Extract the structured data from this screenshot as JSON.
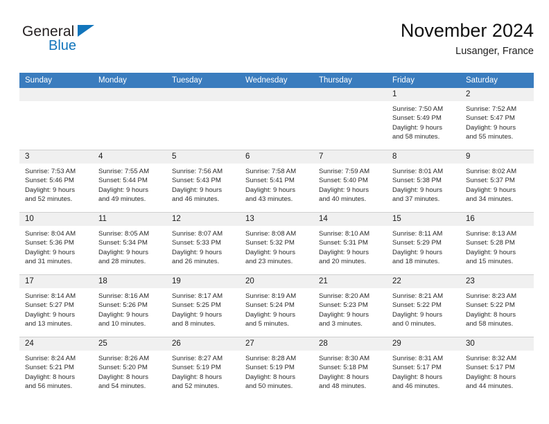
{
  "brand": {
    "name_part1": "General",
    "name_part2": "Blue",
    "triangle_color": "#1275bc",
    "text_color": "#231f20"
  },
  "header": {
    "title": "November 2024",
    "subtitle": "Lusanger, France"
  },
  "theme": {
    "header_blue": "#3a7cbe",
    "daynum_band": "#f0f0f0",
    "grid_line": "#cfcfcf",
    "page_background": "#ffffff"
  },
  "calendar": {
    "weekday_headers": [
      "Sunday",
      "Monday",
      "Tuesday",
      "Wednesday",
      "Thursday",
      "Friday",
      "Saturday"
    ],
    "labels": {
      "sunrise_prefix": "Sunrise:",
      "sunset_prefix": "Sunset:",
      "daylight_prefix": "Daylight:"
    },
    "weeks": [
      [
        {
          "day": "",
          "empty": true,
          "sunrise": "",
          "sunset": "",
          "daylight_line1": "",
          "daylight_line2": ""
        },
        {
          "day": "",
          "empty": true,
          "sunrise": "",
          "sunset": "",
          "daylight_line1": "",
          "daylight_line2": ""
        },
        {
          "day": "",
          "empty": true,
          "sunrise": "",
          "sunset": "",
          "daylight_line1": "",
          "daylight_line2": ""
        },
        {
          "day": "",
          "empty": true,
          "sunrise": "",
          "sunset": "",
          "daylight_line1": "",
          "daylight_line2": ""
        },
        {
          "day": "",
          "empty": true,
          "sunrise": "",
          "sunset": "",
          "daylight_line1": "",
          "daylight_line2": ""
        },
        {
          "day": "1",
          "empty": false,
          "sunrise": "Sunrise: 7:50 AM",
          "sunset": "Sunset: 5:49 PM",
          "daylight_line1": "Daylight: 9 hours",
          "daylight_line2": "and 58 minutes."
        },
        {
          "day": "2",
          "empty": false,
          "sunrise": "Sunrise: 7:52 AM",
          "sunset": "Sunset: 5:47 PM",
          "daylight_line1": "Daylight: 9 hours",
          "daylight_line2": "and 55 minutes."
        }
      ],
      [
        {
          "day": "3",
          "empty": false,
          "sunrise": "Sunrise: 7:53 AM",
          "sunset": "Sunset: 5:46 PM",
          "daylight_line1": "Daylight: 9 hours",
          "daylight_line2": "and 52 minutes."
        },
        {
          "day": "4",
          "empty": false,
          "sunrise": "Sunrise: 7:55 AM",
          "sunset": "Sunset: 5:44 PM",
          "daylight_line1": "Daylight: 9 hours",
          "daylight_line2": "and 49 minutes."
        },
        {
          "day": "5",
          "empty": false,
          "sunrise": "Sunrise: 7:56 AM",
          "sunset": "Sunset: 5:43 PM",
          "daylight_line1": "Daylight: 9 hours",
          "daylight_line2": "and 46 minutes."
        },
        {
          "day": "6",
          "empty": false,
          "sunrise": "Sunrise: 7:58 AM",
          "sunset": "Sunset: 5:41 PM",
          "daylight_line1": "Daylight: 9 hours",
          "daylight_line2": "and 43 minutes."
        },
        {
          "day": "7",
          "empty": false,
          "sunrise": "Sunrise: 7:59 AM",
          "sunset": "Sunset: 5:40 PM",
          "daylight_line1": "Daylight: 9 hours",
          "daylight_line2": "and 40 minutes."
        },
        {
          "day": "8",
          "empty": false,
          "sunrise": "Sunrise: 8:01 AM",
          "sunset": "Sunset: 5:38 PM",
          "daylight_line1": "Daylight: 9 hours",
          "daylight_line2": "and 37 minutes."
        },
        {
          "day": "9",
          "empty": false,
          "sunrise": "Sunrise: 8:02 AM",
          "sunset": "Sunset: 5:37 PM",
          "daylight_line1": "Daylight: 9 hours",
          "daylight_line2": "and 34 minutes."
        }
      ],
      [
        {
          "day": "10",
          "empty": false,
          "sunrise": "Sunrise: 8:04 AM",
          "sunset": "Sunset: 5:36 PM",
          "daylight_line1": "Daylight: 9 hours",
          "daylight_line2": "and 31 minutes."
        },
        {
          "day": "11",
          "empty": false,
          "sunrise": "Sunrise: 8:05 AM",
          "sunset": "Sunset: 5:34 PM",
          "daylight_line1": "Daylight: 9 hours",
          "daylight_line2": "and 28 minutes."
        },
        {
          "day": "12",
          "empty": false,
          "sunrise": "Sunrise: 8:07 AM",
          "sunset": "Sunset: 5:33 PM",
          "daylight_line1": "Daylight: 9 hours",
          "daylight_line2": "and 26 minutes."
        },
        {
          "day": "13",
          "empty": false,
          "sunrise": "Sunrise: 8:08 AM",
          "sunset": "Sunset: 5:32 PM",
          "daylight_line1": "Daylight: 9 hours",
          "daylight_line2": "and 23 minutes."
        },
        {
          "day": "14",
          "empty": false,
          "sunrise": "Sunrise: 8:10 AM",
          "sunset": "Sunset: 5:31 PM",
          "daylight_line1": "Daylight: 9 hours",
          "daylight_line2": "and 20 minutes."
        },
        {
          "day": "15",
          "empty": false,
          "sunrise": "Sunrise: 8:11 AM",
          "sunset": "Sunset: 5:29 PM",
          "daylight_line1": "Daylight: 9 hours",
          "daylight_line2": "and 18 minutes."
        },
        {
          "day": "16",
          "empty": false,
          "sunrise": "Sunrise: 8:13 AM",
          "sunset": "Sunset: 5:28 PM",
          "daylight_line1": "Daylight: 9 hours",
          "daylight_line2": "and 15 minutes."
        }
      ],
      [
        {
          "day": "17",
          "empty": false,
          "sunrise": "Sunrise: 8:14 AM",
          "sunset": "Sunset: 5:27 PM",
          "daylight_line1": "Daylight: 9 hours",
          "daylight_line2": "and 13 minutes."
        },
        {
          "day": "18",
          "empty": false,
          "sunrise": "Sunrise: 8:16 AM",
          "sunset": "Sunset: 5:26 PM",
          "daylight_line1": "Daylight: 9 hours",
          "daylight_line2": "and 10 minutes."
        },
        {
          "day": "19",
          "empty": false,
          "sunrise": "Sunrise: 8:17 AM",
          "sunset": "Sunset: 5:25 PM",
          "daylight_line1": "Daylight: 9 hours",
          "daylight_line2": "and 8 minutes."
        },
        {
          "day": "20",
          "empty": false,
          "sunrise": "Sunrise: 8:19 AM",
          "sunset": "Sunset: 5:24 PM",
          "daylight_line1": "Daylight: 9 hours",
          "daylight_line2": "and 5 minutes."
        },
        {
          "day": "21",
          "empty": false,
          "sunrise": "Sunrise: 8:20 AM",
          "sunset": "Sunset: 5:23 PM",
          "daylight_line1": "Daylight: 9 hours",
          "daylight_line2": "and 3 minutes."
        },
        {
          "day": "22",
          "empty": false,
          "sunrise": "Sunrise: 8:21 AM",
          "sunset": "Sunset: 5:22 PM",
          "daylight_line1": "Daylight: 9 hours",
          "daylight_line2": "and 0 minutes."
        },
        {
          "day": "23",
          "empty": false,
          "sunrise": "Sunrise: 8:23 AM",
          "sunset": "Sunset: 5:22 PM",
          "daylight_line1": "Daylight: 8 hours",
          "daylight_line2": "and 58 minutes."
        }
      ],
      [
        {
          "day": "24",
          "empty": false,
          "sunrise": "Sunrise: 8:24 AM",
          "sunset": "Sunset: 5:21 PM",
          "daylight_line1": "Daylight: 8 hours",
          "daylight_line2": "and 56 minutes."
        },
        {
          "day": "25",
          "empty": false,
          "sunrise": "Sunrise: 8:26 AM",
          "sunset": "Sunset: 5:20 PM",
          "daylight_line1": "Daylight: 8 hours",
          "daylight_line2": "and 54 minutes."
        },
        {
          "day": "26",
          "empty": false,
          "sunrise": "Sunrise: 8:27 AM",
          "sunset": "Sunset: 5:19 PM",
          "daylight_line1": "Daylight: 8 hours",
          "daylight_line2": "and 52 minutes."
        },
        {
          "day": "27",
          "empty": false,
          "sunrise": "Sunrise: 8:28 AM",
          "sunset": "Sunset: 5:19 PM",
          "daylight_line1": "Daylight: 8 hours",
          "daylight_line2": "and 50 minutes."
        },
        {
          "day": "28",
          "empty": false,
          "sunrise": "Sunrise: 8:30 AM",
          "sunset": "Sunset: 5:18 PM",
          "daylight_line1": "Daylight: 8 hours",
          "daylight_line2": "and 48 minutes."
        },
        {
          "day": "29",
          "empty": false,
          "sunrise": "Sunrise: 8:31 AM",
          "sunset": "Sunset: 5:17 PM",
          "daylight_line1": "Daylight: 8 hours",
          "daylight_line2": "and 46 minutes."
        },
        {
          "day": "30",
          "empty": false,
          "sunrise": "Sunrise: 8:32 AM",
          "sunset": "Sunset: 5:17 PM",
          "daylight_line1": "Daylight: 8 hours",
          "daylight_line2": "and 44 minutes."
        }
      ]
    ]
  }
}
